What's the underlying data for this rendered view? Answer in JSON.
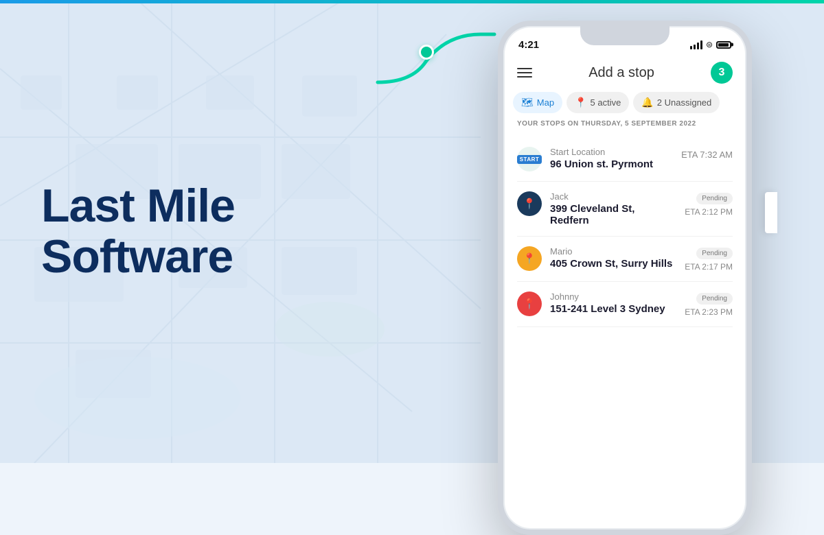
{
  "topBar": {
    "visible": true
  },
  "hero": {
    "line1": "Last Mile",
    "line2": "Software"
  },
  "phone": {
    "statusTime": "4:21",
    "header": {
      "addStopLabel": "Add a stop",
      "badgeCount": "3"
    },
    "tabs": [
      {
        "id": "map",
        "icon": "🗺",
        "label": "Map",
        "state": "active"
      },
      {
        "id": "active",
        "icon": "📍",
        "label": "5 active",
        "state": "normal"
      },
      {
        "id": "unassigned",
        "icon": "🔔",
        "label": "2 Unassigned",
        "state": "normal"
      }
    ],
    "stopsDateHeader": "YOUR STOPS ON THURSDAY, 5 SEPTEMBER 2022",
    "stops": [
      {
        "id": "start",
        "iconType": "start",
        "name": "Start Location",
        "address": "96 Union st. Pyrmont",
        "eta": "ETA 7:32 AM",
        "status": null
      },
      {
        "id": "jack",
        "iconType": "dark",
        "name": "Jack",
        "address": "399 Cleveland St, Redfern",
        "eta": "ETA 2:12 PM",
        "status": "Pending"
      },
      {
        "id": "mario",
        "iconType": "orange",
        "name": "Mario",
        "address": "405 Crown St, Surry Hills",
        "eta": "ETA 2:17 PM",
        "status": "Pending"
      },
      {
        "id": "johnny",
        "iconType": "red",
        "name": "Johnny",
        "address": "151-241 Level 3 Sydney",
        "eta": "ETA 2:23 PM",
        "status": "Pending"
      }
    ]
  }
}
